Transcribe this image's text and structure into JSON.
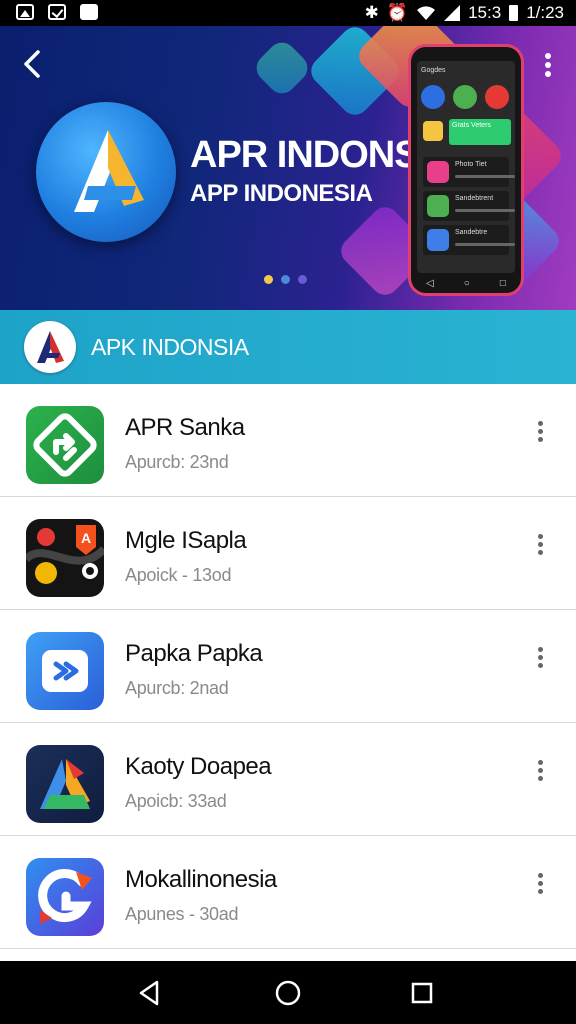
{
  "status_bar": {
    "left_icons": [
      "image-icon",
      "check-icon",
      "photo-icon"
    ],
    "right_icons": [
      "settings-icon",
      "alarm-icon",
      "wifi-icon",
      "signal-icon"
    ],
    "time_left": "15:3",
    "time_right": "1/:23"
  },
  "banner": {
    "title": "APR INDONSIA",
    "subtitle": "APP INDONESIA",
    "phone_screen": {
      "header": "Gogdes",
      "card_text": "Grats Veters",
      "row_labels": [
        "Photo Tiet",
        "Sandebtrent",
        "Sandebtre"
      ]
    },
    "pager": {
      "count": 3,
      "active_index": 0
    },
    "colors": {
      "background_start": "#0a1f6e",
      "background_end": "#a03cc0",
      "accent": "#e0406d"
    }
  },
  "section": {
    "title": "APK INDONSIA",
    "background": "#1ea3c8"
  },
  "apps": [
    {
      "name": "APR Sanka",
      "meta": "Apurcb: 23nd",
      "icon": "green-arrow-icon"
    },
    {
      "name": "Mgle  ISapla",
      "meta": "Apoick - 13od",
      "icon": "map-pins-icon"
    },
    {
      "name": "Papka Papka",
      "meta": "Apurcb: 2nad",
      "icon": "blue-play-icon"
    },
    {
      "name": "Kaoty Doapea",
      "meta": "Apoicb: 33ad",
      "icon": "letter-a-icon"
    },
    {
      "name": "Mokallinonesia",
      "meta": "Apunes - 30ad",
      "icon": "swirl-g-icon"
    }
  ],
  "nav_bar": {
    "buttons": [
      "back-triangle-icon",
      "home-circle-icon",
      "recents-square-icon"
    ]
  }
}
